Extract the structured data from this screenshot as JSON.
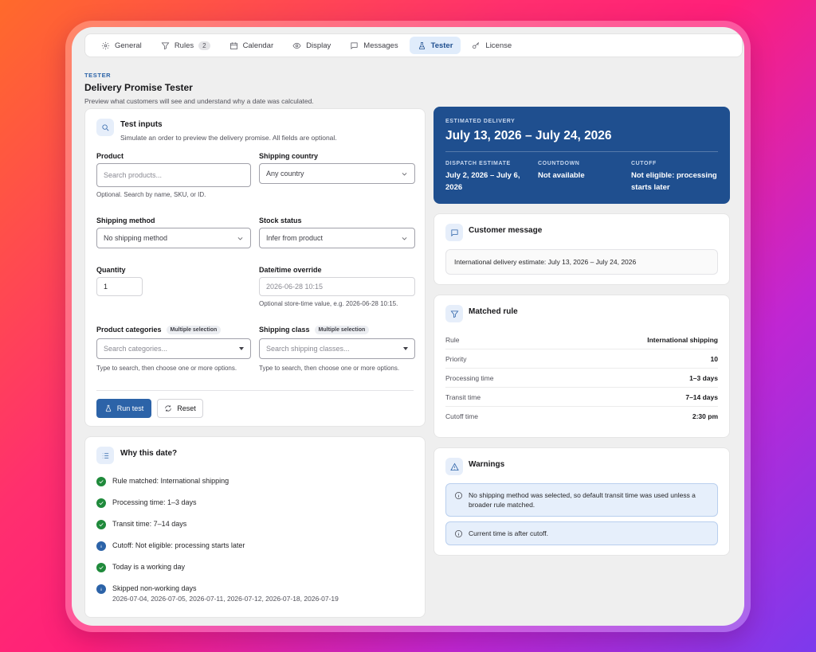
{
  "tabs": [
    {
      "label": "General",
      "icon": "gear-icon"
    },
    {
      "label": "Rules",
      "icon": "filter-icon",
      "badge": "2"
    },
    {
      "label": "Calendar",
      "icon": "calendar-icon"
    },
    {
      "label": "Display",
      "icon": "eye-icon"
    },
    {
      "label": "Messages",
      "icon": "message-icon"
    },
    {
      "label": "Tester",
      "icon": "flask-icon",
      "active": true
    },
    {
      "label": "License",
      "icon": "key-icon"
    }
  ],
  "header": {
    "eyebrow": "TESTER",
    "title": "Delivery Promise Tester",
    "subtitle": "Preview what customers will see and understand why a date was calculated."
  },
  "test_inputs": {
    "title": "Test inputs",
    "subtitle": "Simulate an order to preview the delivery promise. All fields are optional.",
    "product_label": "Product",
    "product_placeholder": "Search products...",
    "product_help": "Optional. Search by name, SKU, or ID.",
    "country_label": "Shipping country",
    "country_value": "Any country",
    "method_label": "Shipping method",
    "method_value": "No shipping method",
    "stock_label": "Stock status",
    "stock_value": "Infer from product",
    "quantity_label": "Quantity",
    "quantity_value": "1",
    "datetime_label": "Date/time override",
    "datetime_placeholder": "2026-06-28 10:15",
    "datetime_help": "Optional store-time value, e.g. 2026-06-28 10:15.",
    "categories_label": "Product categories",
    "categories_pill": "Multiple selection",
    "categories_placeholder": "Search categories...",
    "categories_help": "Type to search, then choose one or more options.",
    "class_label": "Shipping class",
    "class_pill": "Multiple selection",
    "class_placeholder": "Search shipping classes...",
    "class_help": "Type to search, then choose one or more options.",
    "run_label": "Run test",
    "reset_label": "Reset"
  },
  "why": {
    "title": "Why this date?",
    "items": [
      {
        "status": "ok",
        "text": "Rule matched: International shipping"
      },
      {
        "status": "ok",
        "text": "Processing time: 1–3 days"
      },
      {
        "status": "ok",
        "text": "Transit time: 7–14 days"
      },
      {
        "status": "info",
        "text": "Cutoff: Not eligible: processing starts later"
      },
      {
        "status": "ok",
        "text": "Today is a working day"
      },
      {
        "status": "info",
        "text": "Skipped non-working days",
        "detail": "2026-07-04, 2026-07-05, 2026-07-11, 2026-07-12, 2026-07-18, 2026-07-19"
      }
    ]
  },
  "estimate": {
    "label": "ESTIMATED DELIVERY",
    "range": "July 13, 2026 – July 24, 2026",
    "dispatch_label": "DISPATCH ESTIMATE",
    "dispatch_value": "July 2, 2026 – July 6, 2026",
    "countdown_label": "COUNTDOWN",
    "countdown_value": "Not available",
    "cutoff_label": "CUTOFF",
    "cutoff_value": "Not eligible: processing starts later",
    "bg_color": "#1f4f8f"
  },
  "customer_message": {
    "title": "Customer message",
    "text": "International delivery estimate: July 13, 2026 – July 24, 2026"
  },
  "matched_rule": {
    "title": "Matched rule",
    "rows": [
      {
        "key": "Rule",
        "value": "International shipping"
      },
      {
        "key": "Priority",
        "value": "10"
      },
      {
        "key": "Processing time",
        "value": "1–3 days"
      },
      {
        "key": "Transit time",
        "value": "7–14 days"
      },
      {
        "key": "Cutoff time",
        "value": "2:30 pm"
      }
    ]
  },
  "warnings": {
    "title": "Warnings",
    "items": [
      "No shipping method was selected, so default transit time was used unless a broader rule matched.",
      "Current time is after cutoff."
    ]
  }
}
